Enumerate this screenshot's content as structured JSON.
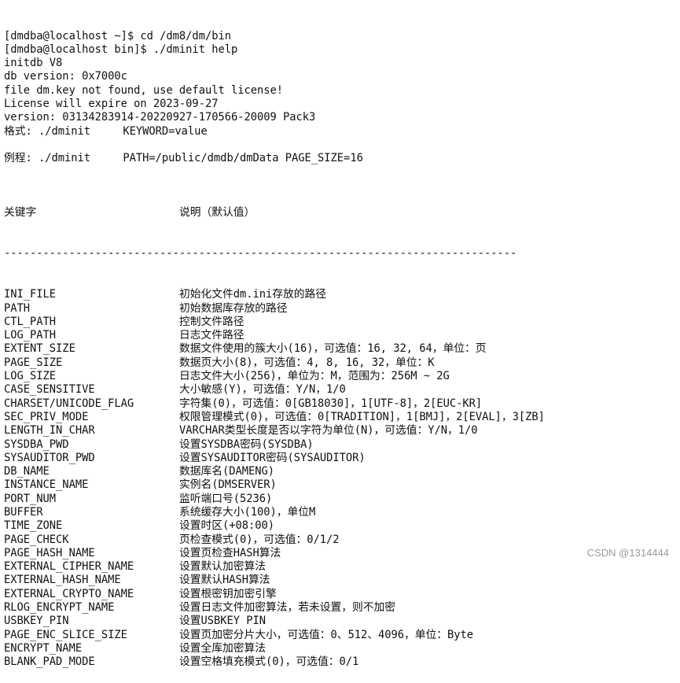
{
  "terminal": {
    "header_lines": [
      "[dmdba@localhost ~]$ cd /dm8/dm/bin",
      "[dmdba@localhost bin]$ ./dminit help",
      "initdb V8",
      "db version: 0x7000c",
      "file dm.key not found, use default license!",
      "License will expire on 2023-09-27",
      "version: 03134283914-20220927-170566-20009 Pack3",
      "格式: ./dminit     KEYWORD=value",
      "",
      "例程: ./dminit     PATH=/public/dmdb/dmData PAGE_SIZE=16",
      ""
    ],
    "table_header": {
      "keyword": "关键字",
      "description": "说明（默认值）"
    },
    "separator": "-------------------------------------------------------------------------------",
    "rows": [
      {
        "keyword": "INI_FILE",
        "description": "初始化文件dm.ini存放的路径"
      },
      {
        "keyword": "PATH",
        "description": "初始数据库存放的路径"
      },
      {
        "keyword": "CTL_PATH",
        "description": "控制文件路径"
      },
      {
        "keyword": "LOG_PATH",
        "description": "日志文件路径"
      },
      {
        "keyword": "EXTENT_SIZE",
        "description": "数据文件使用的簇大小(16)，可选值：16, 32, 64，单位：页"
      },
      {
        "keyword": "PAGE_SIZE",
        "description": "数据页大小(8)，可选值：4, 8, 16, 32，单位：K"
      },
      {
        "keyword": "LOG_SIZE",
        "description": "日志文件大小(256)，单位为：M，范围为：256M ~ 2G"
      },
      {
        "keyword": "CASE_SENSITIVE",
        "description": "大小敏感(Y)，可选值：Y/N，1/0"
      },
      {
        "keyword": "CHARSET/UNICODE_FLAG",
        "description": "字符集(0)，可选值：0[GB18030]，1[UTF-8]，2[EUC-KR]"
      },
      {
        "keyword": "SEC_PRIV_MODE",
        "description": "权限管理模式(0)，可选值：0[TRADITION]，1[BMJ]，2[EVAL]，3[ZB]"
      },
      {
        "keyword": "LENGTH_IN_CHAR",
        "description": "VARCHAR类型长度是否以字符为单位(N)，可选值：Y/N，1/0"
      },
      {
        "keyword": "SYSDBA_PWD",
        "description": "设置SYSDBA密码(SYSDBA)"
      },
      {
        "keyword": "SYSAUDITOR_PWD",
        "description": "设置SYSAUDITOR密码(SYSAUDITOR)"
      },
      {
        "keyword": "DB_NAME",
        "description": "数据库名(DAMENG)"
      },
      {
        "keyword": "INSTANCE_NAME",
        "description": "实例名(DMSERVER)"
      },
      {
        "keyword": "PORT_NUM",
        "description": "监听端口号(5236)"
      },
      {
        "keyword": "BUFFER",
        "description": "系统缓存大小(100)，单位M"
      },
      {
        "keyword": "TIME_ZONE",
        "description": "设置时区(+08:00)"
      },
      {
        "keyword": "PAGE_CHECK",
        "description": "页检查模式(0)，可选值：0/1/2"
      },
      {
        "keyword": "PAGE_HASH_NAME",
        "description": "设置页检查HASH算法"
      },
      {
        "keyword": "EXTERNAL_CIPHER_NAME",
        "description": "设置默认加密算法"
      },
      {
        "keyword": "EXTERNAL_HASH_NAME",
        "description": "设置默认HASH算法"
      },
      {
        "keyword": "EXTERNAL_CRYPTO_NAME",
        "description": "设置根密钥加密引擎"
      },
      {
        "keyword": "RLOG_ENCRYPT_NAME",
        "description": "设置日志文件加密算法，若未设置，则不加密"
      },
      {
        "keyword": "USBKEY_PIN",
        "description": "设置USBKEY PIN"
      },
      {
        "keyword": "PAGE_ENC_SLICE_SIZE",
        "description": "设置页加密分片大小，可选值：0、512、4096，单位：Byte"
      },
      {
        "keyword": "ENCRYPT_NAME",
        "description": "设置全库加密算法"
      },
      {
        "keyword": "BLANK_PAD_MODE",
        "description": "设置空格填充模式(0)，可选值：0/1"
      }
    ]
  },
  "watermark": "CSDN @1314444"
}
